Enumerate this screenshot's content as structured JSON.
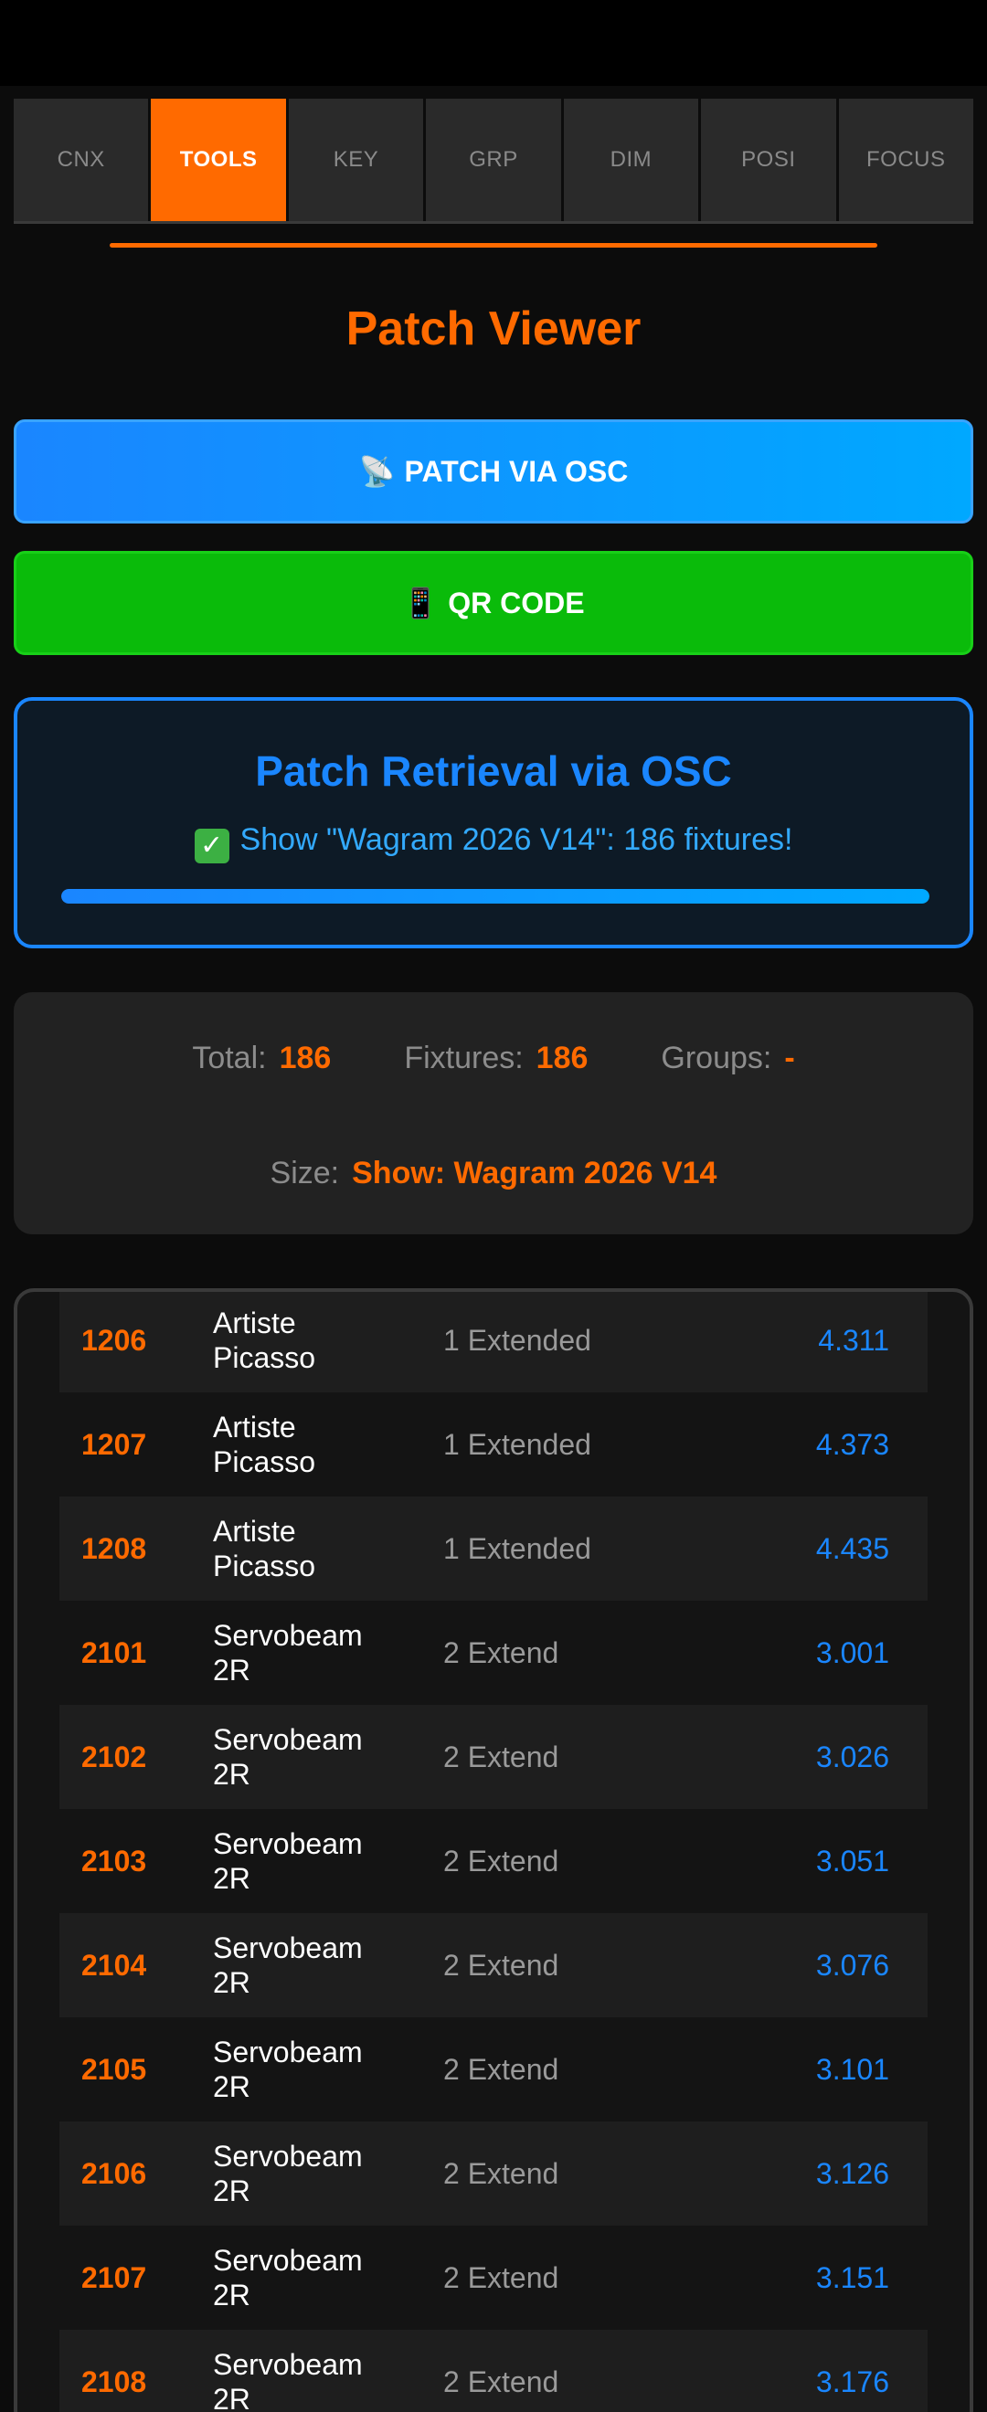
{
  "tabs": [
    {
      "label": "CNX",
      "active": false
    },
    {
      "label": "TOOLS",
      "active": true
    },
    {
      "label": "KEY",
      "active": false
    },
    {
      "label": "GRP",
      "active": false
    },
    {
      "label": "DIM",
      "active": false
    },
    {
      "label": "POSI",
      "active": false
    },
    {
      "label": "FOCUS",
      "active": false
    }
  ],
  "page_title": "Patch Viewer",
  "buttons": {
    "patch_osc": {
      "icon": "satellite-antenna-icon",
      "glyph": "📡",
      "label": "PATCH VIA OSC"
    },
    "qr_code": {
      "icon": "mobile-phone-icon",
      "glyph": "📱",
      "label": "QR CODE"
    }
  },
  "osc_panel": {
    "title": "Patch Retrieval via OSC",
    "status_icon": "check-icon",
    "status_text": "Show \"Wagram 2026 V14\": 186 fixtures!",
    "progress": 1.0
  },
  "stats": {
    "total_label": "Total:",
    "total_value": "186",
    "fixtures_label": "Fixtures:",
    "fixtures_value": "186",
    "groups_label": "Groups:",
    "groups_value": "-",
    "size_label": "Size:",
    "size_value": "Show: Wagram 2026 V14"
  },
  "patch_rows": [
    {
      "id": "1206",
      "name": [
        "Artiste",
        "Picasso"
      ],
      "mode": "1 Extended",
      "address": "4.311"
    },
    {
      "id": "1207",
      "name": [
        "Artiste",
        "Picasso"
      ],
      "mode": "1 Extended",
      "address": "4.373"
    },
    {
      "id": "1208",
      "name": [
        "Artiste",
        "Picasso"
      ],
      "mode": "1 Extended",
      "address": "4.435"
    },
    {
      "id": "2101",
      "name": [
        "Servobeam",
        "2R"
      ],
      "mode": "2 Extend",
      "address": "3.001"
    },
    {
      "id": "2102",
      "name": [
        "Servobeam",
        "2R"
      ],
      "mode": "2 Extend",
      "address": "3.026"
    },
    {
      "id": "2103",
      "name": [
        "Servobeam",
        "2R"
      ],
      "mode": "2 Extend",
      "address": "3.051"
    },
    {
      "id": "2104",
      "name": [
        "Servobeam",
        "2R"
      ],
      "mode": "2 Extend",
      "address": "3.076"
    },
    {
      "id": "2105",
      "name": [
        "Servobeam",
        "2R"
      ],
      "mode": "2 Extend",
      "address": "3.101"
    },
    {
      "id": "2106",
      "name": [
        "Servobeam",
        "2R"
      ],
      "mode": "2 Extend",
      "address": "3.126"
    },
    {
      "id": "2107",
      "name": [
        "Servobeam",
        "2R"
      ],
      "mode": "2 Extend",
      "address": "3.151"
    },
    {
      "id": "2108",
      "name": [
        "Servobeam",
        "2R"
      ],
      "mode": "2 Extend",
      "address": "3.176"
    }
  ],
  "colors": {
    "accent_orange": "#ff6a00",
    "osc_blue": "#1a86ff",
    "qr_green": "#0abb0a",
    "background": "#0c0c0c"
  }
}
